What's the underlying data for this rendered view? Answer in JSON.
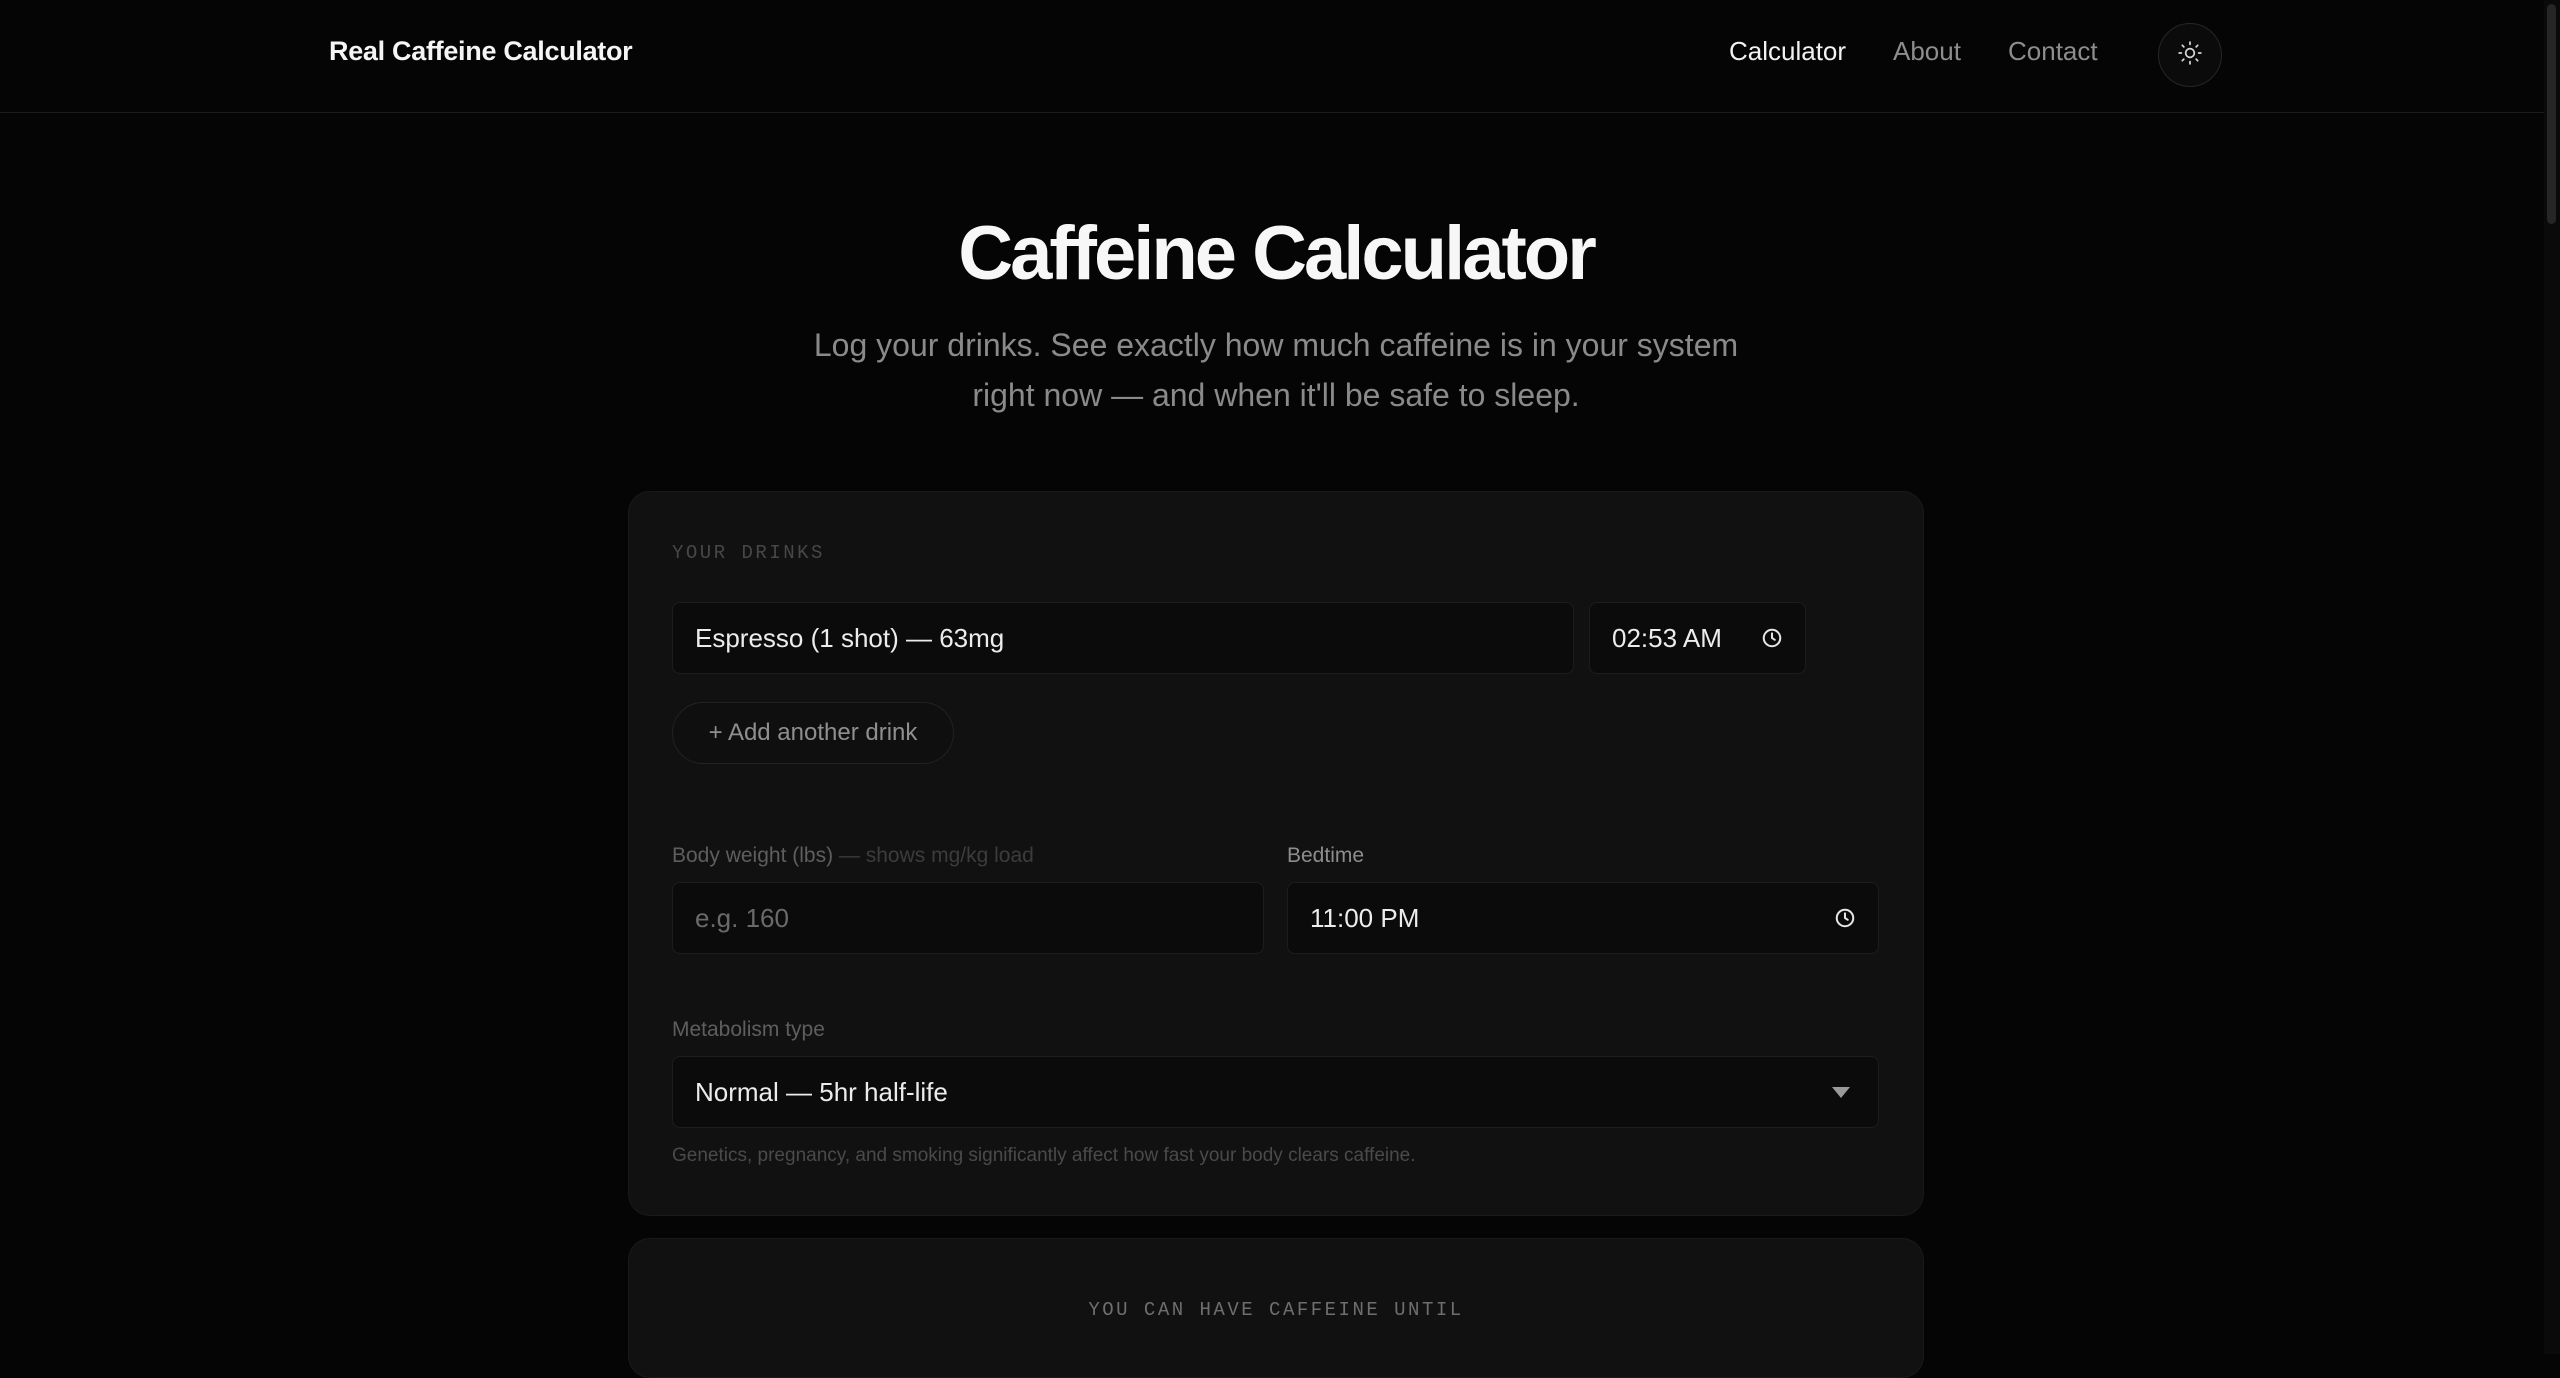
{
  "header": {
    "brand": "Real Caffeine Calculator",
    "nav": {
      "calculator": "Calculator",
      "about": "About",
      "contact": "Contact"
    },
    "theme_icon": "sun-icon"
  },
  "hero": {
    "title": "Caffeine Calculator",
    "subtitle_line1": "Log your drinks. See exactly how much caffeine is in your system",
    "subtitle_line2": "right now — and when it'll be safe to sleep."
  },
  "drinks": {
    "label": "YOUR DRINKS",
    "items": [
      {
        "drink": "Espresso (1 shot) — 63mg",
        "time": "02:53 AM"
      }
    ],
    "add_label": "+ Add another drink"
  },
  "weight": {
    "label": "Body weight (lbs)",
    "hint": " — shows mg/kg load",
    "placeholder": "e.g. 160"
  },
  "bedtime": {
    "label": "Bedtime",
    "value": "11:00 PM"
  },
  "metabolism": {
    "label": "Metabolism type",
    "value": "Normal — 5hr half-life",
    "note": "Genetics, pregnancy, and smoking significantly affect how fast your body clears caffeine."
  },
  "result": {
    "label": "YOU CAN HAVE CAFFEINE UNTIL"
  },
  "colors": {
    "background": "#050505",
    "card": "#111111",
    "field": "#0b0b0b",
    "muted": "#8a8a8a"
  }
}
